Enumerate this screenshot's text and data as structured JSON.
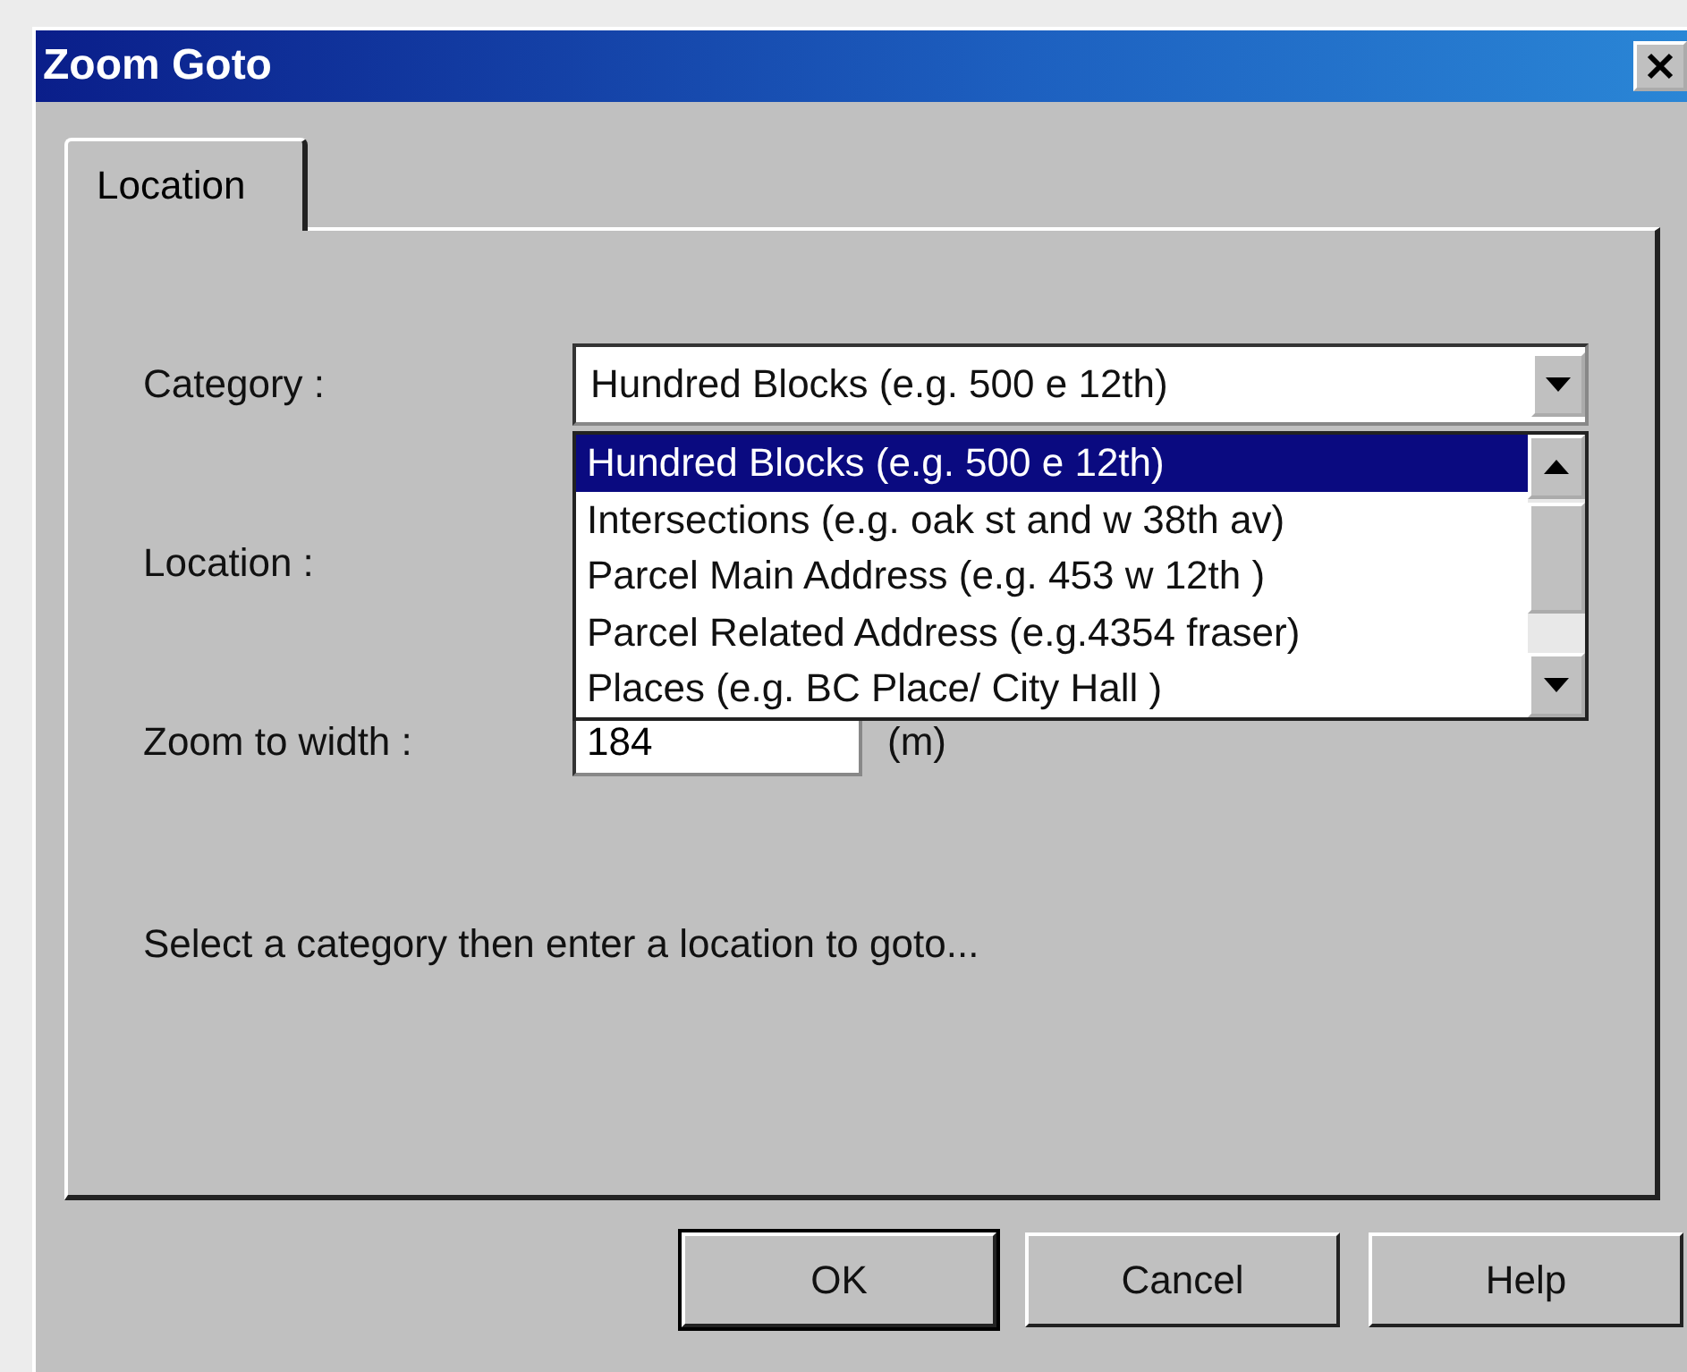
{
  "window": {
    "title": "Zoom Goto"
  },
  "tabs": [
    {
      "label": "Location",
      "selected": true
    }
  ],
  "form": {
    "category_label": "Category :",
    "category_value": "Hundred Blocks (e.g. 500 e 12th)",
    "location_label": "Location :",
    "zoom_label": "Zoom to width :",
    "zoom_value": "184",
    "zoom_unit": "(m)"
  },
  "dropdown": {
    "open": true,
    "items": [
      {
        "label": "Hundred Blocks (e.g. 500 e 12th)",
        "selected": true
      },
      {
        "label": "Intersections (e.g. oak st and w 38th av)",
        "selected": false
      },
      {
        "label": "Parcel Main Address (e.g. 453 w 12th )",
        "selected": false
      },
      {
        "label": "Parcel Related Address (e.g.4354 fraser)",
        "selected": false
      },
      {
        "label": "Places (e.g. BC Place/ City Hall )",
        "selected": false
      }
    ]
  },
  "hint": "Select a category then enter a location to goto...",
  "buttons": [
    {
      "label": "OK",
      "default": true
    },
    {
      "label": "Cancel",
      "default": false
    },
    {
      "label": "Help",
      "default": false
    }
  ]
}
